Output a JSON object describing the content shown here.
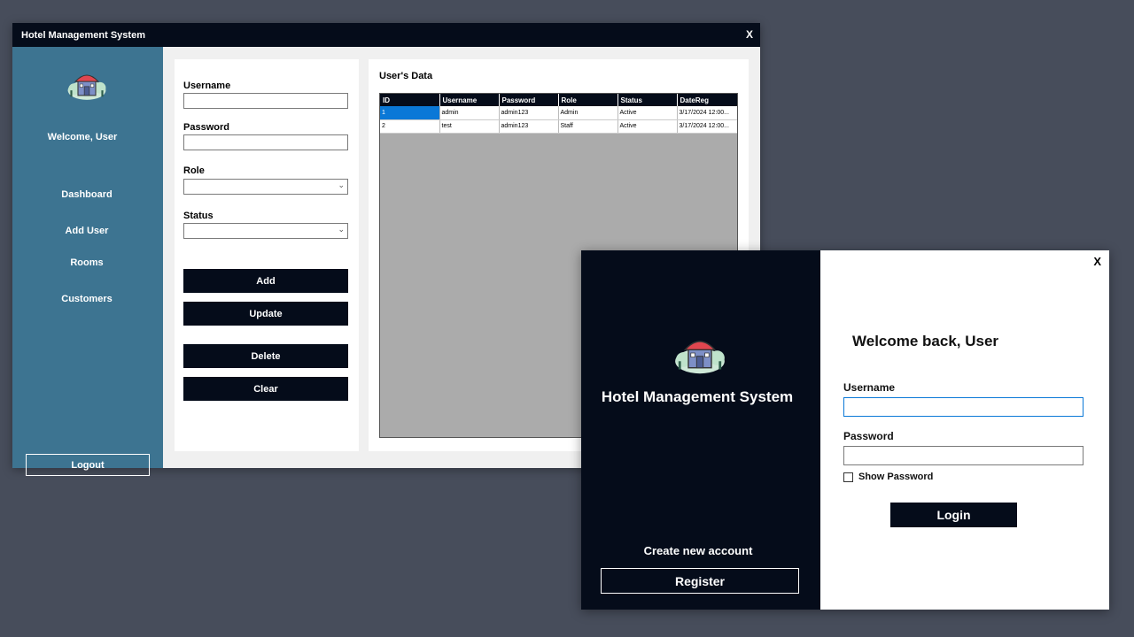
{
  "admin_window": {
    "title": "Hotel Management System",
    "close_label": "X",
    "sidebar": {
      "welcome": "Welcome, User",
      "items": [
        {
          "label": "Dashboard"
        },
        {
          "label": "Add User"
        },
        {
          "label": "Rooms"
        },
        {
          "label": "Customers"
        }
      ],
      "logout_label": "Logout"
    },
    "form": {
      "username_label": "Username",
      "username_value": "",
      "password_label": "Password",
      "password_value": "",
      "role_label": "Role",
      "role_value": "",
      "status_label": "Status",
      "status_value": "",
      "add_label": "Add",
      "update_label": "Update",
      "delete_label": "Delete",
      "clear_label": "Clear"
    },
    "users_table": {
      "title": "User's Data",
      "columns": [
        "ID",
        "Username",
        "Password",
        "Role",
        "Status",
        "DateReg"
      ],
      "rows": [
        [
          "1",
          "admin",
          "admin123",
          "Admin",
          "Active",
          "3/17/2024 12:00..."
        ],
        [
          "2",
          "test",
          "admin123",
          "Staff",
          "Active",
          "3/17/2024 12:00..."
        ]
      ],
      "selected_row": 0
    }
  },
  "login_window": {
    "app_title": "Hotel Management System",
    "close_label": "X",
    "welcome": "Welcome back, User",
    "username_label": "Username",
    "username_value": "",
    "password_label": "Password",
    "password_value": "",
    "show_password_label": "Show Password",
    "show_password_checked": false,
    "login_label": "Login",
    "create_account_label": "Create new account",
    "register_label": "Register"
  },
  "colors": {
    "desktop": "#474d5b",
    "titlebar": "#050c1a",
    "sidebar": "#3d7491",
    "selection": "#0a78d7"
  },
  "icons": {
    "logo": "hotel-logo-icon",
    "combo_arrow": "chevron-down-icon"
  }
}
